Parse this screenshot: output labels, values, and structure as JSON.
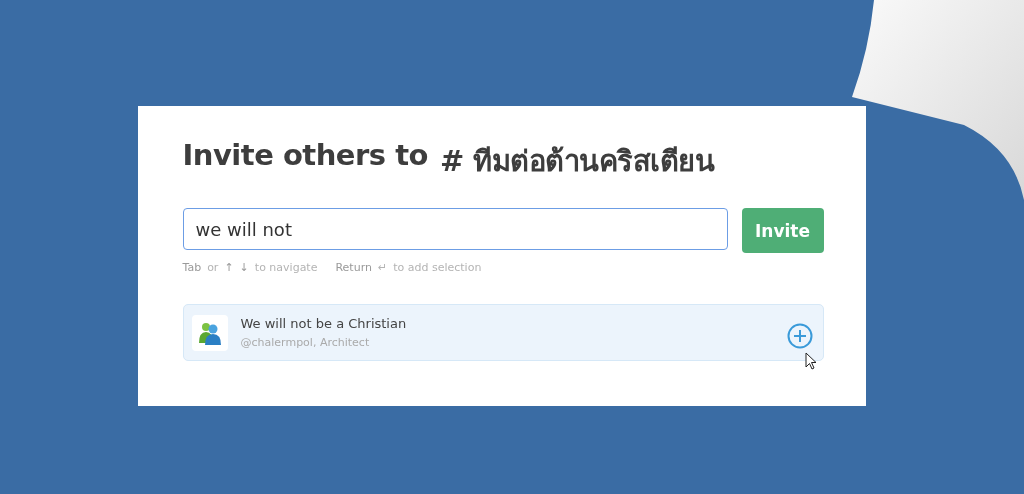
{
  "dialog": {
    "title": "Invite others to",
    "channel": "# ทีมต่อต้านคริสเตียน"
  },
  "search": {
    "value": "we will not"
  },
  "invite_button": {
    "label": "Invite"
  },
  "hints": [
    {
      "kind": "key",
      "text": "Tab"
    },
    {
      "kind": "plain",
      "text": "or"
    },
    {
      "kind": "key",
      "text": "↑"
    },
    {
      "kind": "key",
      "text": "↓"
    },
    {
      "kind": "plain",
      "text": "to navigate"
    },
    {
      "kind": "gap",
      "text": "Return"
    },
    {
      "kind": "plain",
      "text": "↵"
    },
    {
      "kind": "plain",
      "text": "to add selection"
    }
  ],
  "results": [
    {
      "name": "We will not be a Christian",
      "detail": "@chalermpol, Architect"
    }
  ]
}
